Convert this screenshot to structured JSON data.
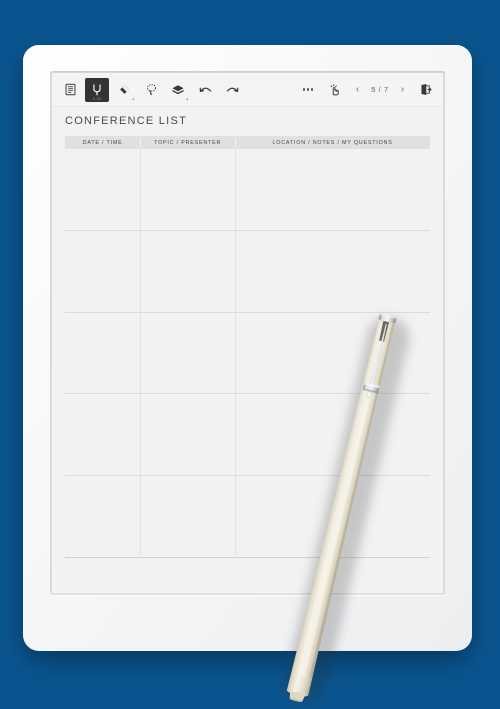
{
  "scene": {
    "background_color": "#0a5590",
    "device_type": "e-ink-tablet"
  },
  "toolbar": {
    "tools": [
      {
        "name": "notes-panel-icon",
        "label": "Notes",
        "active": false,
        "sublabel": ""
      },
      {
        "name": "pen-tool-icon",
        "label": "Pen",
        "active": true,
        "sublabel": "0.35"
      },
      {
        "name": "eraser-tool-icon",
        "label": "Eraser",
        "active": false,
        "sublabel": ""
      },
      {
        "name": "lasso-select-icon",
        "label": "Lasso Select",
        "active": false,
        "sublabel": ""
      },
      {
        "name": "layers-icon",
        "label": "Layers",
        "active": false,
        "sublabel": ""
      },
      {
        "name": "undo-icon",
        "label": "Undo",
        "active": false,
        "sublabel": ""
      },
      {
        "name": "redo-icon",
        "label": "Redo",
        "active": false,
        "sublabel": ""
      }
    ],
    "more_label": "More options",
    "touch_toggle_label": "Touch",
    "prev_page_label": "‹",
    "next_page_label": "›",
    "page_indicator": "5 / 7",
    "current_page": 5,
    "total_pages": 7,
    "exit_label": "Exit"
  },
  "document": {
    "title": "CONFERENCE LIST",
    "table": {
      "columns": [
        "DATE / TIME",
        "TOPIC / PRESENTER",
        "LOCATION / NOTES / MY QUESTIONS"
      ],
      "rows": [
        [
          "",
          "",
          ""
        ],
        [
          "",
          "",
          ""
        ],
        [
          "",
          "",
          ""
        ],
        [
          "",
          "",
          ""
        ],
        [
          "",
          "",
          ""
        ]
      ],
      "row_count": 5,
      "header_background": "#e0e0e0",
      "grid_color": "#dcdcdc"
    }
  },
  "stylus": {
    "name": "stylus-pen",
    "body_color": "#e5dfcd",
    "trim_color": "#b9bcc0"
  }
}
